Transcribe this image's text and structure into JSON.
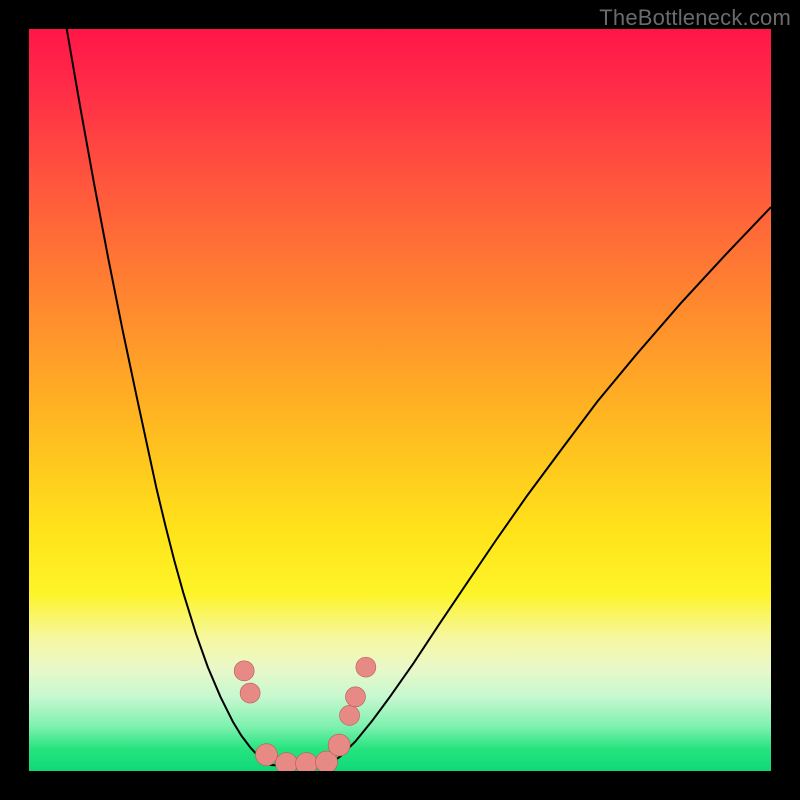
{
  "watermark": {
    "text": "TheBottleneck.com"
  },
  "colors": {
    "curve": "#000000",
    "marker_fill": "#e78a85",
    "marker_stroke": "#b95a55"
  },
  "chart_data": {
    "type": "line",
    "title": "",
    "xlabel": "",
    "ylabel": "",
    "xlim": [
      0,
      1
    ],
    "ylim": [
      0,
      1
    ],
    "series": [
      {
        "name": "left-branch",
        "x": [
          0.05,
          0.069,
          0.088,
          0.107,
          0.126,
          0.145,
          0.159,
          0.172,
          0.184,
          0.196,
          0.208,
          0.225,
          0.241,
          0.258,
          0.275,
          0.286,
          0.298,
          0.311,
          0.325
        ],
        "y": [
          1.005,
          0.895,
          0.79,
          0.69,
          0.595,
          0.505,
          0.44,
          0.38,
          0.33,
          0.283,
          0.24,
          0.185,
          0.14,
          0.1,
          0.066,
          0.048,
          0.032,
          0.018,
          0.008
        ]
      },
      {
        "name": "floor",
        "x": [
          0.325,
          0.345,
          0.365,
          0.385,
          0.404
        ],
        "y": [
          0.008,
          0.007,
          0.007,
          0.007,
          0.008
        ]
      },
      {
        "name": "right-branch",
        "x": [
          0.404,
          0.42,
          0.44,
          0.462,
          0.485,
          0.518,
          0.553,
          0.59,
          0.63,
          0.672,
          0.718,
          0.766,
          0.82,
          0.878,
          0.938,
          1.0
        ],
        "y": [
          0.008,
          0.02,
          0.04,
          0.067,
          0.098,
          0.145,
          0.198,
          0.253,
          0.312,
          0.372,
          0.434,
          0.498,
          0.563,
          0.63,
          0.695,
          0.76
        ]
      }
    ],
    "markers": [
      {
        "x": 0.29,
        "y": 0.135,
        "r": 10
      },
      {
        "x": 0.298,
        "y": 0.105,
        "r": 10
      },
      {
        "x": 0.32,
        "y": 0.022,
        "r": 11
      },
      {
        "x": 0.347,
        "y": 0.01,
        "r": 11
      },
      {
        "x": 0.374,
        "y": 0.01,
        "r": 11
      },
      {
        "x": 0.401,
        "y": 0.012,
        "r": 11
      },
      {
        "x": 0.418,
        "y": 0.035,
        "r": 11
      },
      {
        "x": 0.432,
        "y": 0.075,
        "r": 10
      },
      {
        "x": 0.44,
        "y": 0.1,
        "r": 10
      },
      {
        "x": 0.454,
        "y": 0.14,
        "r": 10
      }
    ]
  }
}
